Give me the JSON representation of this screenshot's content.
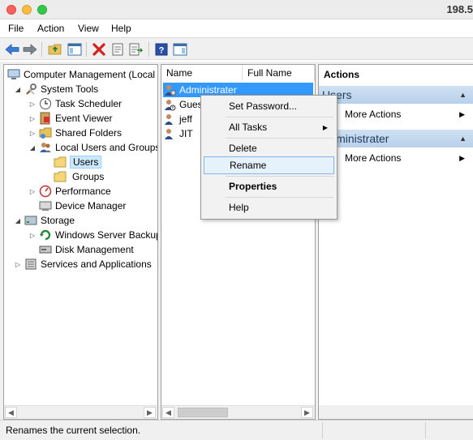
{
  "titlebar": {
    "ip_fragment": "198.5"
  },
  "menu": [
    "File",
    "Action",
    "View",
    "Help"
  ],
  "tree": {
    "root": "Computer Management (Local",
    "system_tools": "System Tools",
    "task_scheduler": "Task Scheduler",
    "event_viewer": "Event Viewer",
    "shared_folders": "Shared Folders",
    "local_users_groups": "Local Users and Groups",
    "users": "Users",
    "groups": "Groups",
    "performance": "Performance",
    "device_manager": "Device Manager",
    "storage": "Storage",
    "windows_server_backup": "Windows Server Backup",
    "disk_management": "Disk Management",
    "services_apps": "Services and Applications"
  },
  "list": {
    "col_name": "Name",
    "col_fullname": "Full Name",
    "rows": [
      "Administrater",
      "Gues",
      "jeff",
      "JIT"
    ]
  },
  "actions": {
    "header": "Actions",
    "section_users": "Users",
    "more_actions_1": "More Actions",
    "section_admin": "Administrater",
    "more_actions_2": "More Actions"
  },
  "context_menu": {
    "set_password": "Set Password...",
    "all_tasks": "All Tasks",
    "delete": "Delete",
    "rename": "Rename",
    "properties": "Properties",
    "help": "Help"
  },
  "status": {
    "text": "Renames the current selection."
  },
  "colors": {
    "selection": "#3399ff",
    "action_header": "#c4d9ef",
    "hover": "#e5f1fb"
  }
}
